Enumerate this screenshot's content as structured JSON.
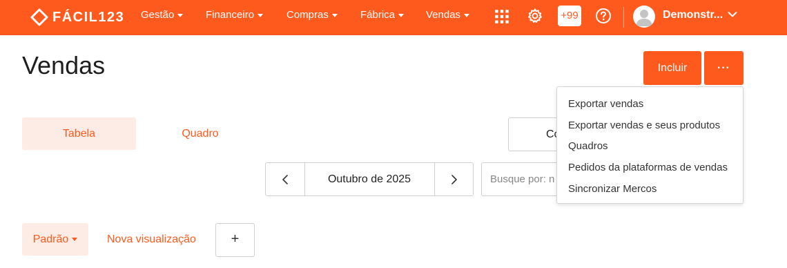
{
  "brand": {
    "name": "FÁCIL123",
    "primary_color": "#fe5a1d",
    "tint_color": "#fdece6"
  },
  "nav": [
    {
      "label": "Gestão"
    },
    {
      "label": "Financeiro"
    },
    {
      "label": "Compras"
    },
    {
      "label": "Fábrica"
    },
    {
      "label": "Vendas"
    }
  ],
  "top_icons": {
    "apps": "grid-icon",
    "settings": "gear-icon",
    "help": "help-icon"
  },
  "notifications": {
    "count": "+99"
  },
  "user": {
    "name": "Demonstr..."
  },
  "page": {
    "title": "Vendas",
    "include_label": "Incluir",
    "more_label": "···"
  },
  "tabs": [
    {
      "label": "Tabela",
      "active": true
    },
    {
      "label": "Quadro",
      "active": false
    }
  ],
  "partial_button": {
    "label": "Co"
  },
  "month_nav": {
    "label": "Outubro de 2025"
  },
  "search": {
    "placeholder": "Busque por: n"
  },
  "views": {
    "default_label": "Padrão",
    "new_label": "Nova visualização",
    "add_label": "+"
  },
  "more_menu": [
    {
      "label": "Exportar vendas"
    },
    {
      "label": "Exportar vendas e seus produtos"
    },
    {
      "label": "Quadros"
    },
    {
      "label": "Pedidos da plataformas de vendas"
    },
    {
      "label": "Sincronizar Mercos"
    }
  ]
}
